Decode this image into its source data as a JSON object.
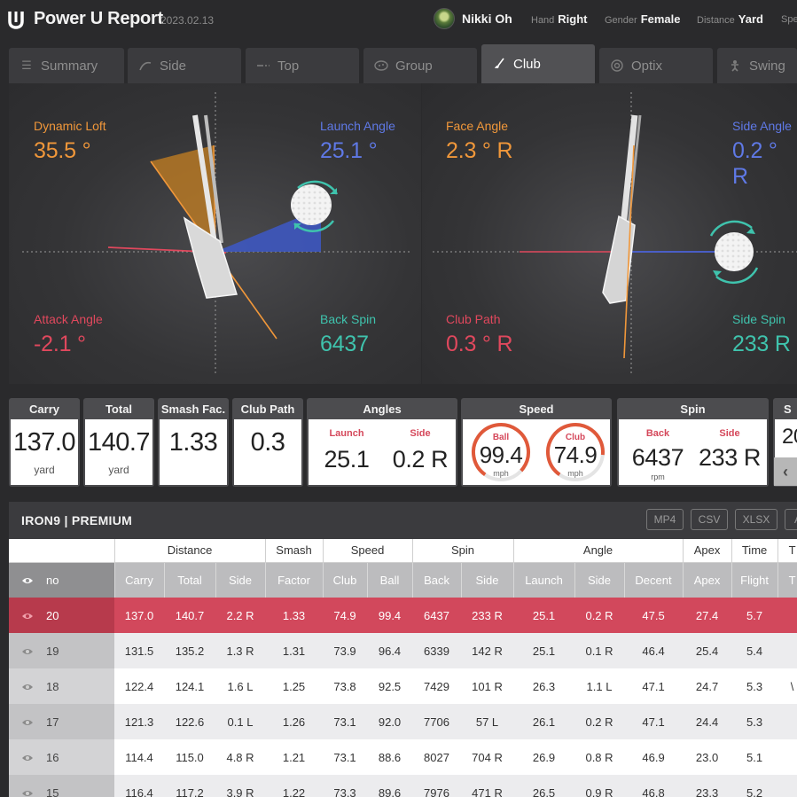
{
  "header": {
    "app_title": "Power U Report",
    "date": "2023.02.13",
    "user_name": "Nikki Oh",
    "hand_label": "Hand",
    "hand_value": "Right",
    "gender_label": "Gender",
    "gender_value": "Female",
    "distance_label": "Distance",
    "distance_value": "Yard",
    "speed_label": "Spe"
  },
  "tabs": [
    {
      "label": "Summary",
      "icon": "list-icon",
      "active": false
    },
    {
      "label": "Side",
      "icon": "side-swing-icon",
      "active": false
    },
    {
      "label": "Top",
      "icon": "top-view-icon",
      "active": false
    },
    {
      "label": "Group",
      "icon": "group-icon",
      "active": false
    },
    {
      "label": "Club",
      "icon": "club-icon",
      "active": true
    },
    {
      "label": "Optix",
      "icon": "optix-icon",
      "active": false
    },
    {
      "label": "Swing",
      "icon": "swing-icon",
      "active": false
    }
  ],
  "side_view": {
    "dynamic_loft": {
      "label": "Dynamic Loft",
      "value": "35.5 °"
    },
    "launch_angle": {
      "label": "Launch Angle",
      "value": "25.1 °"
    },
    "attack_angle": {
      "label": "Attack Angle",
      "value": "-2.1 °"
    },
    "back_spin": {
      "label": "Back Spin",
      "value": "6437"
    }
  },
  "face_view": {
    "face_angle": {
      "label": "Face Angle",
      "value": "2.3 ° R"
    },
    "side_angle": {
      "label": "Side Angle",
      "value": "0.2 ° R"
    },
    "club_path": {
      "label": "Club Path",
      "value": "0.3 ° R"
    },
    "side_spin": {
      "label": "Side Spin",
      "value": "233 R"
    }
  },
  "colors": {
    "loft": "#f0973a",
    "launch": "#5f79e6",
    "attack": "#e0485d",
    "spin": "#3fc3ad",
    "highlight_row": "#d2485c"
  },
  "stats": {
    "carry": {
      "title": "Carry",
      "value": "137.0",
      "unit": "yard"
    },
    "total": {
      "title": "Total",
      "value": "140.7",
      "unit": "yard"
    },
    "smash": {
      "title": "Smash Fac.",
      "value": "1.33"
    },
    "club_path": {
      "title": "Club Path",
      "value": "0.3"
    },
    "angles": {
      "title": "Angles",
      "launch_label": "Launch",
      "launch_value": "25.1",
      "side_label": "Side",
      "side_value": "0.2 R"
    },
    "speed": {
      "title": "Speed",
      "ball_label": "Ball",
      "ball_value": "99.4",
      "ball_unit": "mph",
      "club_label": "Club",
      "club_value": "74.9",
      "club_unit": "mph"
    },
    "spin": {
      "title": "Spin",
      "back_label": "Back",
      "back_value": "6437",
      "back_unit": "rpm",
      "side_label": "Side",
      "side_value": "233 R"
    },
    "partial": {
      "title": "S",
      "value": "20"
    }
  },
  "table": {
    "title": "IRON9 | PREMIUM",
    "export_buttons": [
      "MP4",
      "CSV",
      "XLSX",
      "A"
    ],
    "groups": [
      "Distance",
      "Smash",
      "Speed",
      "Spin",
      "Angle",
      "Apex",
      "Time",
      "T"
    ],
    "columns": [
      "no",
      "Carry",
      "Total",
      "Side",
      "Factor",
      "Club",
      "Ball",
      "Back",
      "Side",
      "Launch",
      "Side",
      "Decent",
      "Apex",
      "Flight",
      "T"
    ],
    "rows": [
      {
        "no": "20",
        "cells": [
          "137.0",
          "140.7",
          "2.2 R",
          "1.33",
          "74.9",
          "99.4",
          "6437",
          "233 R",
          "25.1",
          "0.2 R",
          "47.5",
          "27.4",
          "5.7",
          ""
        ],
        "highlighted": true
      },
      {
        "no": "19",
        "cells": [
          "131.5",
          "135.2",
          "1.3 R",
          "1.31",
          "73.9",
          "96.4",
          "6339",
          "142 R",
          "25.1",
          "0.1 R",
          "46.4",
          "25.4",
          "5.4",
          ""
        ],
        "highlighted": false
      },
      {
        "no": "18",
        "cells": [
          "122.4",
          "124.1",
          "1.6 L",
          "1.25",
          "73.8",
          "92.5",
          "7429",
          "101 R",
          "26.3",
          "1.1 L",
          "47.1",
          "24.7",
          "5.3",
          "\\"
        ],
        "highlighted": false
      },
      {
        "no": "17",
        "cells": [
          "121.3",
          "122.6",
          "0.1 L",
          "1.26",
          "73.1",
          "92.0",
          "7706",
          "57 L",
          "26.1",
          "0.2 R",
          "47.1",
          "24.4",
          "5.3",
          ""
        ],
        "highlighted": false
      },
      {
        "no": "16",
        "cells": [
          "114.4",
          "115.0",
          "4.8 R",
          "1.21",
          "73.1",
          "88.6",
          "8027",
          "704 R",
          "26.9",
          "0.8 R",
          "46.9",
          "23.0",
          "5.1",
          ""
        ],
        "highlighted": false
      },
      {
        "no": "15",
        "cells": [
          "116.4",
          "117.2",
          "3.9 R",
          "1.22",
          "73.3",
          "89.6",
          "7976",
          "471 R",
          "26.5",
          "0.9 R",
          "46.8",
          "23.3",
          "5.2",
          ""
        ],
        "highlighted": false
      }
    ]
  }
}
